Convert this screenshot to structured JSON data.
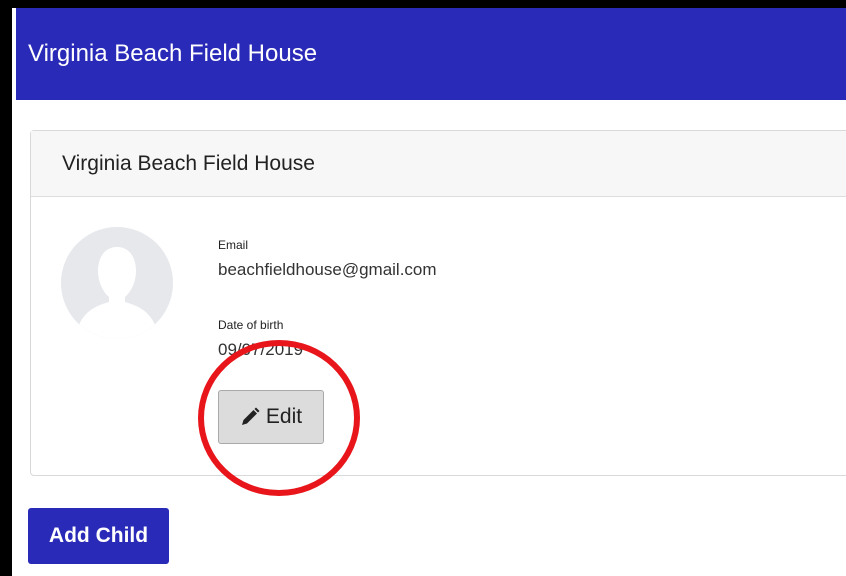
{
  "header": {
    "title": "Virginia Beach Field House"
  },
  "card": {
    "title": "Virginia Beach Field House",
    "email_label": "Email",
    "email_value": "beachfieldhouse@gmail.com",
    "dob_label": "Date of birth",
    "dob_value": "09/07/2019",
    "edit_label": "Edit",
    "avatar_icon": "user-silhouette-icon",
    "edit_icon": "pencil-icon"
  },
  "actions": {
    "add_child_label": "Add Child"
  },
  "annotation": {
    "highlight_color": "#e8151b",
    "target": "edit-button"
  },
  "colors": {
    "brand": "#2a2ab8",
    "page_background": "#ffffff",
    "card_header_background": "#f7f7f7",
    "button_gray": "#dcdcdc"
  }
}
